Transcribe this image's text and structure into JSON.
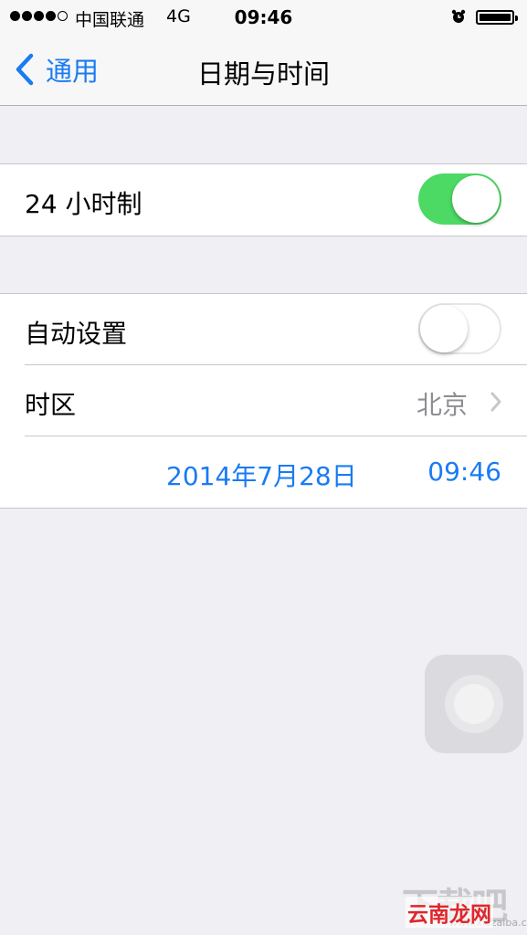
{
  "status_bar": {
    "carrier": "中国联通",
    "network": "4G",
    "time": "09:46",
    "signal_bars": 4,
    "signal_total": 5
  },
  "nav": {
    "back_label": "通用",
    "title": "日期与时间"
  },
  "settings": {
    "hour24": {
      "label": "24 小时制",
      "enabled": true
    },
    "auto_set": {
      "label": "自动设置",
      "enabled": false
    },
    "timezone": {
      "label": "时区",
      "value": "北京"
    },
    "date": "2014年7月28日",
    "time": "09:46"
  },
  "colors": {
    "accent": "#1a7bf3",
    "toggle_on": "#4cd964",
    "background": "#efeff4"
  },
  "watermark": {
    "main": "下载吧",
    "url": "www.xiazaiba.com",
    "overlay": "云南龙网"
  }
}
